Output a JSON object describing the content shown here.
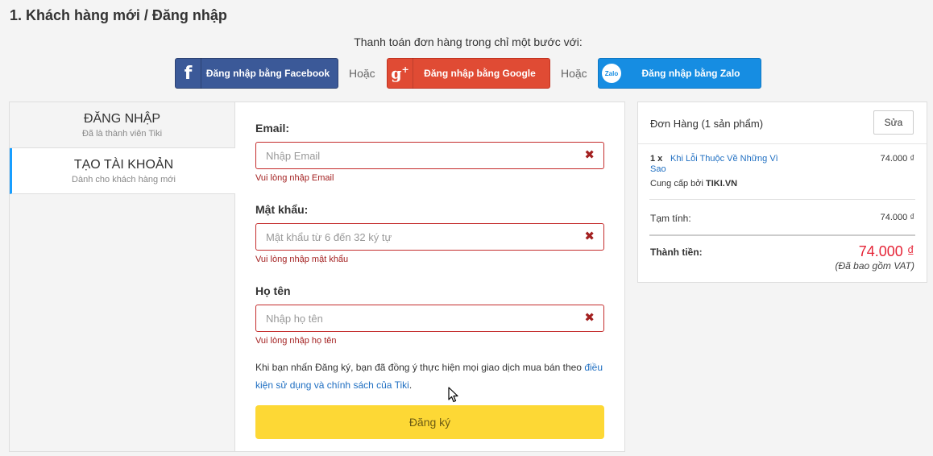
{
  "step": {
    "title": "1. Khách hàng mới / Đăng nhập"
  },
  "social": {
    "intro": "Thanh toán đơn hàng trong chỉ một bước với:",
    "facebook_label": "Đăng nhập bằng Facebook",
    "google_label": "Đăng nhập bằng Google",
    "zalo_label": "Đăng nhập bằng Zalo",
    "or_text": "Hoặc",
    "facebook_icon": "facebook-f-icon",
    "google_icon": "google-plus-icon",
    "zalo_icon": "zalo-icon",
    "facebook_color": "#3b5998",
    "google_color": "#e04b34",
    "zalo_color": "#168de2",
    "zalo_icon_text": "Zalo"
  },
  "tabs": [
    {
      "title": "ĐĂNG NHẬP",
      "subtitle": "Đã là thành viên Tiki",
      "active": false
    },
    {
      "title": "TẠO TÀI KHOẢN",
      "subtitle": "Dành cho khách hàng mới",
      "active": true
    }
  ],
  "form": {
    "email": {
      "label": "Email:",
      "placeholder": "Nhập Email",
      "value": "",
      "error": "Vui lòng nhập Email"
    },
    "password": {
      "label": "Mật khẩu:",
      "placeholder": "Mật khẩu từ 6 đến 32 ký tự",
      "value": "",
      "error": "Vui lòng nhập mật khẩu"
    },
    "fullname": {
      "label": "Họ tên",
      "placeholder": "Nhập họ tên",
      "value": "",
      "error": "Vui lòng nhập họ tên"
    },
    "clear_icon": "✖",
    "terms_text": "Khi bạn nhấn Đăng ký, bạn đã đồng ý thực hiện mọi giao dịch mua bán theo ",
    "terms_link": "điều kiện sử dụng và chính sách của Tiki",
    "terms_end": ".",
    "submit_label": "Đăng ký",
    "error_color": "#c42c2c",
    "submit_color": "#fdd835"
  },
  "order": {
    "header": "Đơn Hàng (1 sản phẩm)",
    "edit_label": "Sửa",
    "item": {
      "qty": "1 x",
      "name": "Khi Lỗi Thuộc Về Những Vì Sao",
      "price": "74.000 ₫",
      "seller_prefix": "Cung cấp bởi ",
      "seller": "TIKI.VN"
    },
    "subtotal_label": "Tạm tính:",
    "subtotal_value": "74.000 ₫",
    "total_label": "Thành tiền:",
    "total_value": "74.000 ₫",
    "vat_note": "(Đã bao gồm VAT)",
    "total_color": "#e52437"
  }
}
